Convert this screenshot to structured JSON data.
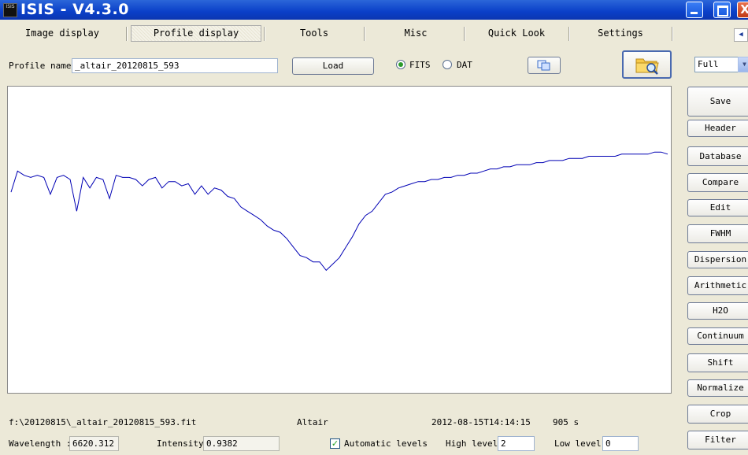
{
  "window": {
    "title": "ISIS - V4.3.0",
    "app_icon_text": "ISIS",
    "close_glyph": "X"
  },
  "tabs": [
    {
      "label": "Image display"
    },
    {
      "label": "Profile display",
      "selected": true
    },
    {
      "label": "Tools"
    },
    {
      "label": "Misc"
    },
    {
      "label": "Quick Look"
    },
    {
      "label": "Settings"
    }
  ],
  "profile": {
    "name_label": "Profile name",
    "name_value": "_altair_20120815_593",
    "load_label": "Load",
    "format_options": [
      {
        "label": "FITS",
        "selected": true
      },
      {
        "label": "DAT",
        "selected": false
      }
    ]
  },
  "icons": {
    "copy": "copy-icon",
    "open_folder": "folder-search-icon",
    "tab_scroll": "chevron-left-icon"
  },
  "zoom_select": {
    "value": "Full"
  },
  "side_buttons": [
    "Save",
    "Header",
    "Database",
    "Compare",
    "Edit",
    "FWHM",
    "Dispersion",
    "Arithmetic",
    "H2O",
    "Continuum",
    "Shift",
    "Normalize",
    "Crop",
    "Filter"
  ],
  "info": {
    "file_path": "f:\\20120815\\_altair_20120815_593.fit",
    "object": "Altair",
    "date_obs": "2012-08-15T14:14:15",
    "exposure": "905 s"
  },
  "status": {
    "wavelength_label": "Wavelength :",
    "wavelength_value": "6620.312",
    "intensity_label": "Intensity",
    "intensity_value": "0.9382",
    "auto_levels_label": "Automatic levels",
    "auto_levels_checked": true,
    "high_level_label": "High level",
    "high_level_value": "2",
    "low_level_label": "Low level",
    "low_level_value": "0"
  },
  "chart_data": {
    "type": "line",
    "title": "",
    "xlabel": "",
    "ylabel": "",
    "grid": false,
    "line_color": "#0000b4",
    "ylim": [
      0,
      1.45
    ],
    "x": [
      0,
      0.01,
      0.02,
      0.03,
      0.04,
      0.05,
      0.06,
      0.07,
      0.08,
      0.09,
      0.1,
      0.11,
      0.12,
      0.13,
      0.14,
      0.15,
      0.16,
      0.17,
      0.18,
      0.19,
      0.2,
      0.21,
      0.22,
      0.23,
      0.24,
      0.25,
      0.26,
      0.27,
      0.28,
      0.29,
      0.3,
      0.31,
      0.32,
      0.33,
      0.34,
      0.35,
      0.36,
      0.37,
      0.38,
      0.39,
      0.4,
      0.41,
      0.42,
      0.43,
      0.44,
      0.45,
      0.46,
      0.47,
      0.48,
      0.49,
      0.5,
      0.51,
      0.52,
      0.53,
      0.54,
      0.55,
      0.56,
      0.57,
      0.58,
      0.59,
      0.6,
      0.61,
      0.62,
      0.63,
      0.64,
      0.65,
      0.66,
      0.67,
      0.68,
      0.69,
      0.7,
      0.71,
      0.72,
      0.73,
      0.74,
      0.75,
      0.76,
      0.77,
      0.78,
      0.79,
      0.8,
      0.81,
      0.82,
      0.83,
      0.84,
      0.85,
      0.86,
      0.87,
      0.88,
      0.89,
      0.9,
      0.91,
      0.92,
      0.93,
      0.94,
      0.95,
      0.96,
      0.97,
      0.98,
      0.99,
      1.0
    ],
    "y": [
      0.95,
      1.05,
      1.03,
      1.02,
      1.03,
      1.02,
      0.94,
      1.02,
      1.03,
      1.01,
      0.86,
      1.02,
      0.97,
      1.02,
      1.01,
      0.92,
      1.03,
      1.02,
      1.02,
      1.01,
      0.98,
      1.01,
      1.02,
      0.97,
      1.0,
      1.0,
      0.98,
      0.99,
      0.94,
      0.98,
      0.94,
      0.97,
      0.96,
      0.93,
      0.92,
      0.88,
      0.86,
      0.84,
      0.82,
      0.79,
      0.77,
      0.76,
      0.73,
      0.69,
      0.65,
      0.64,
      0.62,
      0.62,
      0.58,
      0.61,
      0.64,
      0.69,
      0.74,
      0.8,
      0.84,
      0.86,
      0.9,
      0.94,
      0.95,
      0.97,
      0.98,
      0.99,
      1.0,
      1.0,
      1.01,
      1.01,
      1.02,
      1.02,
      1.03,
      1.03,
      1.04,
      1.04,
      1.05,
      1.06,
      1.06,
      1.07,
      1.07,
      1.08,
      1.08,
      1.08,
      1.09,
      1.09,
      1.1,
      1.1,
      1.1,
      1.11,
      1.11,
      1.11,
      1.12,
      1.12,
      1.12,
      1.12,
      1.12,
      1.13,
      1.13,
      1.13,
      1.13,
      1.13,
      1.14,
      1.14,
      1.13
    ]
  }
}
